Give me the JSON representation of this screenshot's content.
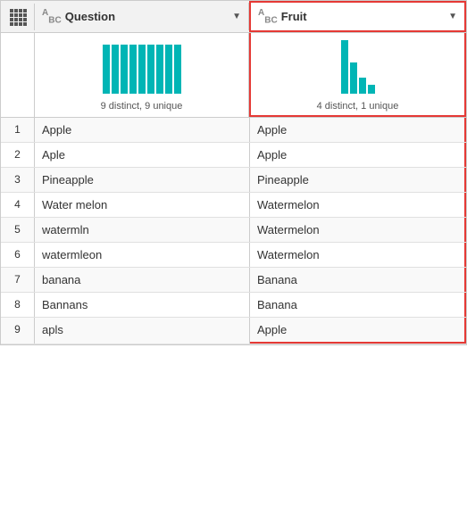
{
  "header": {
    "grid_icon": "grid",
    "col1": {
      "type_icon": "ABC",
      "label": "Question",
      "arrow": "▼"
    },
    "col2": {
      "type_icon": "ABC",
      "label": "Fruit",
      "arrow": "▼"
    }
  },
  "stats": {
    "col1": {
      "text": "9 distinct, 9 unique",
      "bars": [
        55,
        55,
        55,
        55,
        55,
        55,
        55,
        55,
        55
      ]
    },
    "col2": {
      "text": "4 distinct, 1 unique",
      "bars": [
        60,
        35,
        18,
        10
      ]
    }
  },
  "rows": [
    {
      "num": "1",
      "question": "Apple",
      "fruit": "Apple"
    },
    {
      "num": "2",
      "question": "Aple",
      "fruit": "Apple"
    },
    {
      "num": "3",
      "question": "Pineapple",
      "fruit": "Pineapple"
    },
    {
      "num": "4",
      "question": "Water melon",
      "fruit": "Watermelon"
    },
    {
      "num": "5",
      "question": "watermln",
      "fruit": "Watermelon"
    },
    {
      "num": "6",
      "question": "watermleon",
      "fruit": "Watermelon"
    },
    {
      "num": "7",
      "question": "banana",
      "fruit": "Banana"
    },
    {
      "num": "8",
      "question": "Bannans",
      "fruit": "Banana"
    },
    {
      "num": "9",
      "question": "apls",
      "fruit": "Apple"
    }
  ],
  "colors": {
    "accent": "#00b5b5",
    "border_highlight": "#e53935"
  }
}
